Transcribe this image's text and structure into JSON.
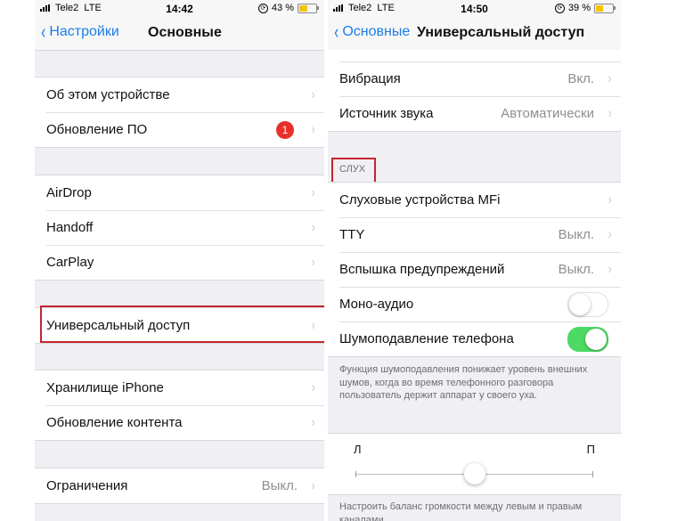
{
  "left": {
    "status": {
      "carrier": "Tele2",
      "network": "LTE",
      "time": "14:42",
      "battery_text": "43 %",
      "battery_level": 0.43
    },
    "nav": {
      "back_label": "Настройки",
      "title": "Основные"
    },
    "groups": [
      {
        "rows": [
          {
            "label": "Об этом устройстве"
          },
          {
            "label": "Обновление ПО",
            "badge": "1"
          }
        ]
      },
      {
        "rows": [
          {
            "label": "AirDrop"
          },
          {
            "label": "Handoff"
          },
          {
            "label": "CarPlay"
          }
        ]
      },
      {
        "rows": [
          {
            "label": "Универсальный доступ",
            "highlighted": true
          }
        ]
      },
      {
        "rows": [
          {
            "label": "Хранилище iPhone"
          },
          {
            "label": "Обновление контента"
          }
        ]
      },
      {
        "rows": [
          {
            "label": "Ограничения",
            "value": "Выкл."
          }
        ]
      }
    ]
  },
  "right": {
    "status": {
      "carrier": "Tele2",
      "network": "LTE",
      "time": "14:50",
      "battery_text": "39 %",
      "battery_level": 0.39
    },
    "nav": {
      "back_label": "Основные",
      "title": "Универсальный доступ"
    },
    "top_group": [
      {
        "label": "Вибрация",
        "value": "Вкл."
      },
      {
        "label": "Источник звука",
        "value": "Автоматически"
      }
    ],
    "hearing_section": {
      "header": "СЛУХ",
      "rows": [
        {
          "label": "Слуховые устройства MFi"
        },
        {
          "label": "TTY",
          "value": "Выкл."
        },
        {
          "label": "Вспышка предупреждений",
          "value": "Выкл."
        },
        {
          "label": "Моно-аудио",
          "toggle": false
        },
        {
          "label": "Шумоподавление телефона",
          "toggle": true
        }
      ],
      "footer": "Функция шумоподавления понижает уровень внешних шумов, когда во время телефонного разговора пользователь держит аппарат у своего уха."
    },
    "balance": {
      "left_label": "Л",
      "right_label": "П",
      "value": 0.5,
      "footer": "Настроить баланс громкости между левым и правым каналами"
    }
  },
  "icons": {
    "chevron": "›",
    "back_chevron": "‹"
  },
  "colors": {
    "accent": "#1a7ee8",
    "toggle_on": "#4cd964",
    "badge": "#e8302a",
    "highlight": "#c4262d"
  }
}
